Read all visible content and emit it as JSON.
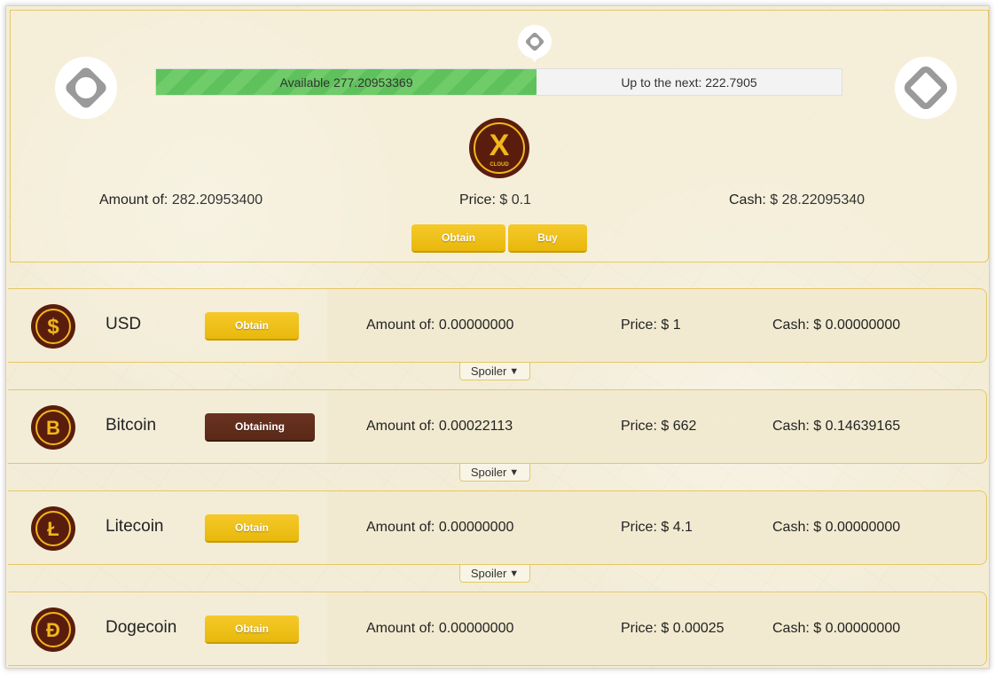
{
  "progress": {
    "available_label": "Available",
    "available_value": "277.20953369",
    "next_label": "Up to the next:",
    "next_value": "222.7905",
    "fill_fraction": 0.555
  },
  "main_coin": {
    "logo_letter": "X",
    "logo_text": "CLOUD",
    "amount_label": "Amount of:",
    "amount_value": "282.20953400",
    "price_label": "Price:",
    "price_value": "$ 0.1",
    "cash_label": "Cash:",
    "cash_value": "$ 28.22095340",
    "obtain_label": "Obtain",
    "buy_label": "Buy"
  },
  "coins": [
    {
      "name": "USD",
      "icon": "dollar-icon",
      "symbol": "$",
      "button_label": "Obtain",
      "button_state": "obtain",
      "amount_label": "Amount of:",
      "amount_value": "0.00000000",
      "price_label": "Price:",
      "price_value": "$ 1",
      "cash_label": "Cash:",
      "cash_value": "$ 0.00000000",
      "spoiler_label": "Spoiler"
    },
    {
      "name": "Bitcoin",
      "icon": "bitcoin-icon",
      "symbol": "B",
      "button_label": "Obtaining",
      "button_state": "obtaining",
      "amount_label": "Amount of:",
      "amount_value": "0.00022113",
      "price_label": "Price:",
      "price_value": "$ 662",
      "cash_label": "Cash:",
      "cash_value": "$ 0.14639165",
      "spoiler_label": "Spoiler"
    },
    {
      "name": "Litecoin",
      "icon": "litecoin-icon",
      "symbol": "Ł",
      "button_label": "Obtain",
      "button_state": "obtain",
      "amount_label": "Amount of:",
      "amount_value": "0.00000000",
      "price_label": "Price:",
      "price_value": "$ 4.1",
      "cash_label": "Cash:",
      "cash_value": "$ 0.00000000",
      "spoiler_label": "Spoiler"
    },
    {
      "name": "Dogecoin",
      "icon": "dogecoin-icon",
      "symbol": "Đ",
      "button_label": "Obtain",
      "button_state": "obtain",
      "amount_label": "Amount of:",
      "amount_value": "0.00000000",
      "price_label": "Price:",
      "price_value": "$ 0.00025",
      "cash_label": "Cash:",
      "cash_value": "$ 0.00000000"
    }
  ],
  "colors": {
    "accent_gold": "#e8b80c",
    "coin_brown": "#5a1d0d",
    "progress_green": "#5fc15c",
    "panel_border": "#e6c765",
    "obtaining_brown": "#5a2918"
  }
}
